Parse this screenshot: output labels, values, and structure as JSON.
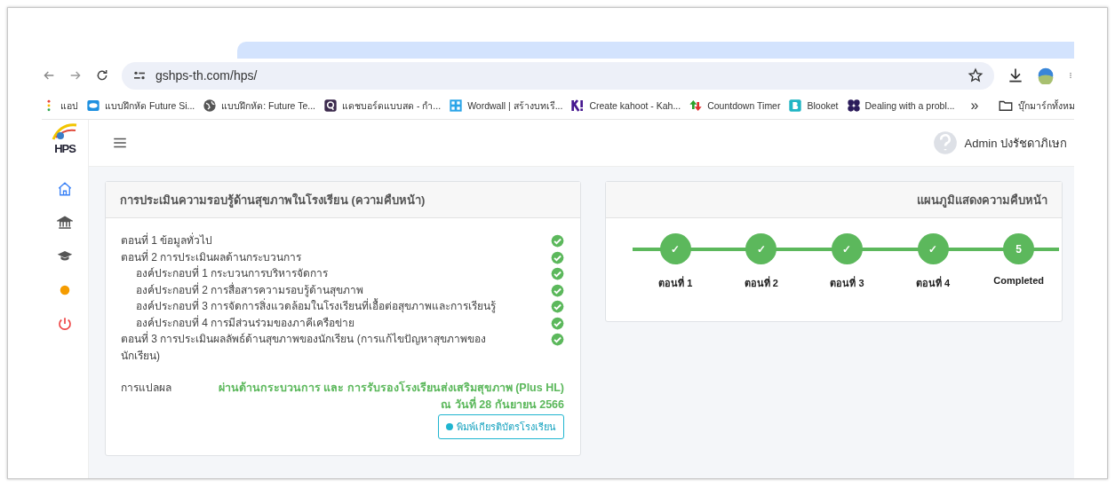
{
  "browser": {
    "url": "gshps-th.com/hps/",
    "bookmarks": [
      {
        "kind": "apps",
        "label": "แอป"
      },
      {
        "kind": "bubble",
        "label": "แบบฝึกหัด Future Si..."
      },
      {
        "kind": "globe",
        "label": "แบบฝึกหัด: Future Te..."
      },
      {
        "kind": "q",
        "label": "แดชบอร์ดแบบสด - กำ..."
      },
      {
        "kind": "grid",
        "label": "Wordwall | สร้างบทเรี..."
      },
      {
        "kind": "k",
        "label": "Create kahoot - Kah..."
      },
      {
        "kind": "arrows",
        "label": "Countdown Timer"
      },
      {
        "kind": "b",
        "label": "Blooket"
      },
      {
        "kind": "dots",
        "label": "Dealing with a probl..."
      }
    ],
    "more": "»",
    "all_bookmarks": "บุ๊กมาร์กทั้งหม"
  },
  "sidebar": {
    "logo_text": "HPS",
    "items": [
      {
        "kind": "home",
        "selected": true
      },
      {
        "kind": "bank",
        "selected": false
      },
      {
        "kind": "cap",
        "selected": false
      },
      {
        "kind": "dot",
        "selected": false
      },
      {
        "kind": "power",
        "selected": false
      }
    ]
  },
  "topbar": {
    "user": "Admin ปงรัชดาภิเษก"
  },
  "checklist_card": {
    "title": "การประเมินความรอบรู้ด้านสุขภาพในโรงเรียน (ความคืบหน้า)",
    "items": [
      {
        "label": "ตอนที่ 1 ข้อมูลทั่วไป",
        "checked": true
      },
      {
        "label": "ตอนที่ 2 การประเมินผลด้านกระบวนการ",
        "checked": true,
        "children": [
          {
            "label": "องค์ประกอบที่ 1 กระบวนการบริหารจัดการ",
            "checked": true
          },
          {
            "label": "องค์ประกอบที่ 2 การสื่อสารความรอบรู้ด้านสุขภาพ",
            "checked": true
          },
          {
            "label": "องค์ประกอบที่ 3 การจัดการสิ่งแวดล้อมในโรงเรียนที่เอื้อต่อสุขภาพและการเรียนรู้",
            "checked": true
          },
          {
            "label": "องค์ประกอบที่ 4 การมีส่วนร่วมของภาคีเครือข่าย",
            "checked": true
          }
        ]
      },
      {
        "label": "ตอนที่ 3 การประเมินผลลัพธ์ด้านสุขภาพของนักเรียน (การแก้ไขปัญหาสุขภาพของนักเรียน)",
        "checked": true
      }
    ],
    "result_label": "การแปลผล",
    "result_lines": [
      "ผ่านด้านกระบวนการ และ การรับรองโรงเรียนส่งเสริมสุขภาพ (Plus HL)",
      "ณ วันที่ 28 กันยายน 2566"
    ],
    "print_button": "พิมพ์เกียรติบัตรโรงเรียน"
  },
  "progress_card": {
    "title": "แผนภูมิแสดงความคืบหน้า",
    "steps": [
      {
        "mark": "✓",
        "label": "ตอนที่ 1"
      },
      {
        "mark": "✓",
        "label": "ตอนที่ 2"
      },
      {
        "mark": "✓",
        "label": "ตอนที่ 3"
      },
      {
        "mark": "✓",
        "label": "ตอนที่ 4"
      },
      {
        "mark": "5",
        "label": "Completed"
      }
    ]
  }
}
